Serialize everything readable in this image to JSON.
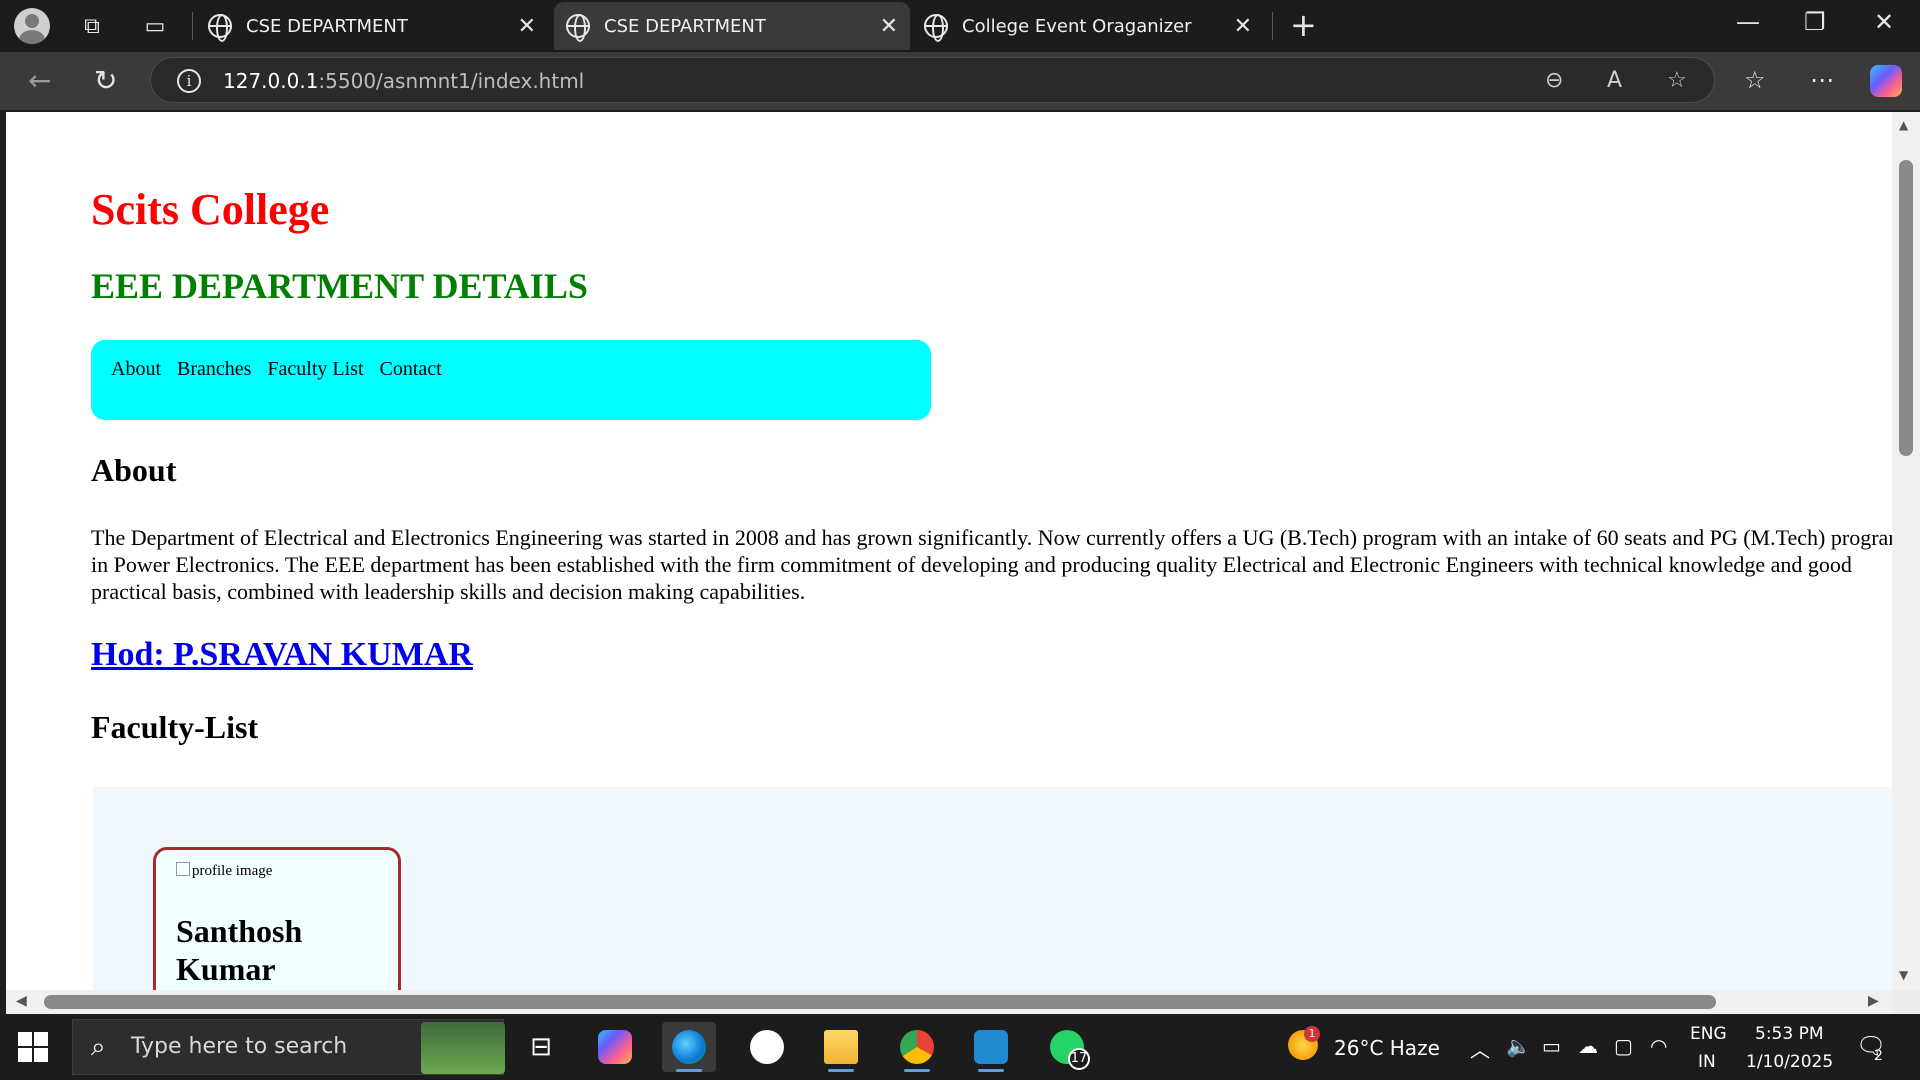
{
  "browser": {
    "tabs": [
      {
        "title": "CSE DEPARTMENT",
        "active": false
      },
      {
        "title": "CSE DEPARTMENT",
        "active": true
      },
      {
        "title": "College Event Oraganizer",
        "active": false
      }
    ],
    "url_host": "127.0.0.1",
    "url_path": ":5500/asnmnt1/index.html"
  },
  "page": {
    "college_title": "Scits College",
    "dept_title": "EEE DEPARTMENT DETAILS",
    "nav_links": [
      "About",
      "Branches",
      "Faculty List",
      "Contact"
    ],
    "about_heading": "About",
    "about_text": "The Department of Electrical and Electronics Engineering was started in 2008 and has grown significantly. Now currently offers a UG (B.Tech) program with an intake of 60 seats and PG (M.Tech) programs in Power Electronics. The EEE department has been established with the firm commitment of developing and producing quality Electrical and Electronic Engineers with technical knowledge and good practical basis, combined with leadership skills and decision making capabilities.",
    "hod_link": "Hod: P.SRAVAN KUMAR",
    "faculty_heading": "Faculty-List",
    "faculty": [
      {
        "img_alt": "profile image",
        "name": "Santhosh Kumar"
      }
    ]
  },
  "taskbar": {
    "search_placeholder": "Type here to search",
    "whatsapp_badge": "17",
    "weather_badge": "1",
    "weather_text": "26°C  Haze",
    "lang_top": "ENG",
    "lang_bottom": "IN",
    "time": "5:53 PM",
    "date": "1/10/2025",
    "notification_count": "2"
  },
  "colors": {
    "college_title": "#ff0000",
    "dept_title": "#008000",
    "nav_bg": "#00ffff",
    "hod_link": "#0000ee",
    "faculty_bg": "#f0f8ff",
    "card_border": "#a52a2a"
  }
}
